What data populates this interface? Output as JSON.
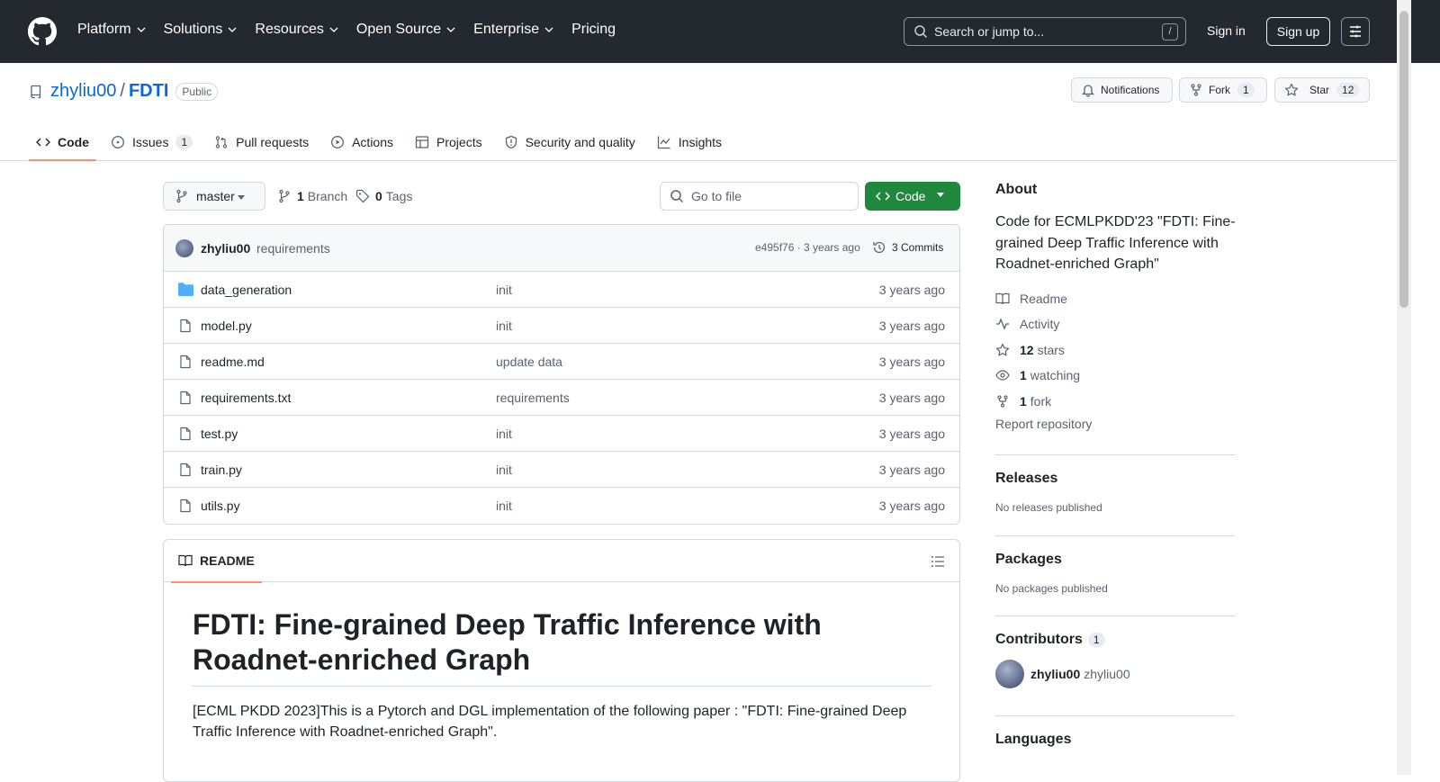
{
  "header": {
    "nav": [
      "Platform",
      "Solutions",
      "Resources",
      "Open Source",
      "Enterprise",
      "Pricing"
    ],
    "search_placeholder": "Search or jump to...",
    "search_shortcut": "/",
    "signin": "Sign in",
    "signup": "Sign up"
  },
  "repo": {
    "owner": "zhyliu00",
    "separator": "/",
    "name": "FDTI",
    "visibility": "Public",
    "notifications": "Notifications",
    "fork_label": "Fork",
    "fork_count": "1",
    "star_label": "Star",
    "star_count": "12"
  },
  "tabs": {
    "code": "Code",
    "issues": "Issues",
    "issues_count": "1",
    "pulls": "Pull requests",
    "actions": "Actions",
    "projects": "Projects",
    "security": "Security and quality",
    "insights": "Insights"
  },
  "toolbar": {
    "branch": "master",
    "branch_count": "1",
    "branch_label": "Branch",
    "tag_count": "0",
    "tag_label": "Tags",
    "goto_placeholder": "Go to file",
    "code_button": "Code"
  },
  "commit": {
    "author": "zhyliu00",
    "message": "requirements",
    "hash_time": "e495f76 · 3 years ago",
    "commits": "3 Commits"
  },
  "files": [
    {
      "name": "data_generation",
      "type": "folder",
      "message": "init",
      "date": "3 years ago"
    },
    {
      "name": "model.py",
      "type": "file",
      "message": "init",
      "date": "3 years ago"
    },
    {
      "name": "readme.md",
      "type": "file",
      "message": "update data",
      "date": "3 years ago"
    },
    {
      "name": "requirements.txt",
      "type": "file",
      "message": "requirements",
      "date": "3 years ago"
    },
    {
      "name": "test.py",
      "type": "file",
      "message": "init",
      "date": "3 years ago"
    },
    {
      "name": "train.py",
      "type": "file",
      "message": "init",
      "date": "3 years ago"
    },
    {
      "name": "utils.py",
      "type": "file",
      "message": "init",
      "date": "3 years ago"
    }
  ],
  "readme": {
    "tab": "README",
    "title": "FDTI: Fine-grained Deep Traffic Inference with Roadnet-enriched Graph",
    "text": "[ECML PKDD 2023]This is a Pytorch and DGL implementation of the following paper : \"FDTI: Fine-grained Deep Traffic Inference with Roadnet-enriched Graph\"."
  },
  "sidebar": {
    "about_title": "About",
    "description": "Code for ECMLPKDD'23 \"FDTI: Fine-grained Deep Traffic Inference with Roadnet-enriched Graph\"",
    "readme": "Readme",
    "activity": "Activity",
    "stars_count": "12",
    "stars": "stars",
    "watching_count": "1",
    "watching": "watching",
    "fork_count": "1",
    "fork": "fork",
    "report": "Report repository",
    "releases_title": "Releases",
    "releases_text": "No releases published",
    "packages_title": "Packages",
    "packages_text": "No packages published",
    "contributors_title": "Contributors",
    "contributors_count": "1",
    "contributor_login": "zhyliu00",
    "contributor_name": "zhyliu00",
    "languages_title": "Languages"
  },
  "colors": {
    "header_bg": "#24292f",
    "link": "#0969da",
    "primary_button": "#1f883d",
    "active_tab_underline": "#fd8c73",
    "folder_icon": "#54aeff"
  }
}
